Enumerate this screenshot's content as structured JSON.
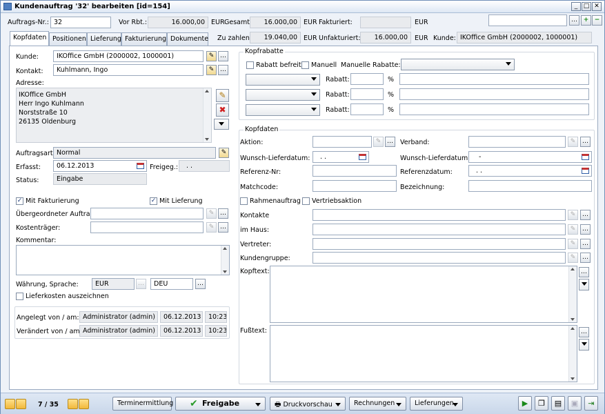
{
  "window": {
    "title": "Kundenauftrag '32' bearbeiten [id=154]"
  },
  "header": {
    "auftrags_nr_label": "Auftrags-Nr.:",
    "auftrags_nr": "32",
    "vor_rbt_label": "Vor Rbt.:",
    "vor_rbt": "16.000,00",
    "cur1": "EUR",
    "gesamt_label": "Gesamt:",
    "gesamt": "16.000,00",
    "cur2": "EUR",
    "fakturiert_label": "Fakturiert:",
    "fakturiert": "",
    "cur3": "EUR",
    "zu_zahlen_label": "Zu zahlen:",
    "zu_zahlen": "19.040,00",
    "cur4": "EUR",
    "unfakturiert_label": "Unfakturiert:",
    "unfakturiert": "16.000,00",
    "cur5": "EUR",
    "kunde_label": "Kunde:",
    "kunde": "IKOffice GmbH (2000002, 1000001)"
  },
  "tabs": [
    "Kopfdaten",
    "Positionen",
    "Lieferung",
    "Fakturierung",
    "Dokumente"
  ],
  "left": {
    "kunde_label": "Kunde:",
    "kunde": "IKOffice GmbH (2000002, 1000001)",
    "kontakt_label": "Kontakt:",
    "kontakt": "Kuhlmann, Ingo",
    "adresse_label": "Adresse:",
    "adresse": [
      "IKOffice GmbH",
      "Herr Ingo Kuhlmann",
      "Norststraße 10",
      "26135 Oldenburg"
    ],
    "auftragsart_label": "Auftragsart:",
    "auftragsart": "Normal",
    "erfasst_label": "Erfasst:",
    "erfasst": "06.12.2013",
    "freigeg_label": "Freigeg.:",
    "freigeg": ". .",
    "status_label": "Status:",
    "status": "Eingabe",
    "mit_fakturierung": "Mit Fakturierung",
    "mit_lieferung": "Mit Lieferung",
    "uebergeordneter_label": "Übergeordneter Auftrag:",
    "kostentraeger_label": "Kostenträger:",
    "kommentar_label": "Kommentar:",
    "waehrung_label": "Währung, Sprache:",
    "waehrung": "EUR",
    "sprache": "DEU",
    "lieferkosten": "Lieferkosten auszeichnen",
    "angelegt_label": "Angelegt von / am:",
    "angelegt_user": "Administrator (admin)",
    "angelegt_date": "06.12.2013",
    "angelegt_time": "10:23",
    "veraendert_label": "Verändert von / am:",
    "veraendert_user": "Administrator (admin)",
    "veraendert_date": "06.12.2013",
    "veraendert_time": "10:23"
  },
  "kopfrabatte": {
    "title": "Kopfrabatte",
    "rabatt_befreit": "Rabatt befreit",
    "manuell": "Manuell",
    "manuelle_rabatte": "Manuelle Rabatte:",
    "rabatt_label": "Rabatt:",
    "percent": "%"
  },
  "kopfdaten": {
    "title": "Kopfdaten",
    "aktion": "Aktion:",
    "verband": "Verband:",
    "wunsch_lieferdatum": "Wunsch-Lieferdatum:",
    "wunsch_lieferdatum_val": ". .",
    "wunsch_lieferdatum2": "Wunsch-Lieferdatum:",
    "wunsch_lieferdatum2_val": "-",
    "referenz_nr": "Referenz-Nr:",
    "referenzdatum": "Referenzdatum:",
    "referenzdatum_val": ". .",
    "matchcode": "Matchcode:",
    "bezeichnung": "Bezeichnung:",
    "rahmenauftrag": "Rahmenauftrag",
    "vertriebsaktion": "Vertriebsaktion",
    "kontakte": "Kontakte",
    "im_haus": "im Haus:",
    "vertreter": "Vertreter:",
    "kundengruppe": "Kundengruppe:",
    "kopftext": "Kopftext:",
    "fusstext": "Fußtext:"
  },
  "bottom": {
    "page": "7 / 35",
    "terminermittlung": "Terminermittlung",
    "freigabe": "Freigabe",
    "druckvorschau": "Druckvorschau",
    "rechnungen": "Rechnungen",
    "lieferungen": "Lieferungen"
  }
}
